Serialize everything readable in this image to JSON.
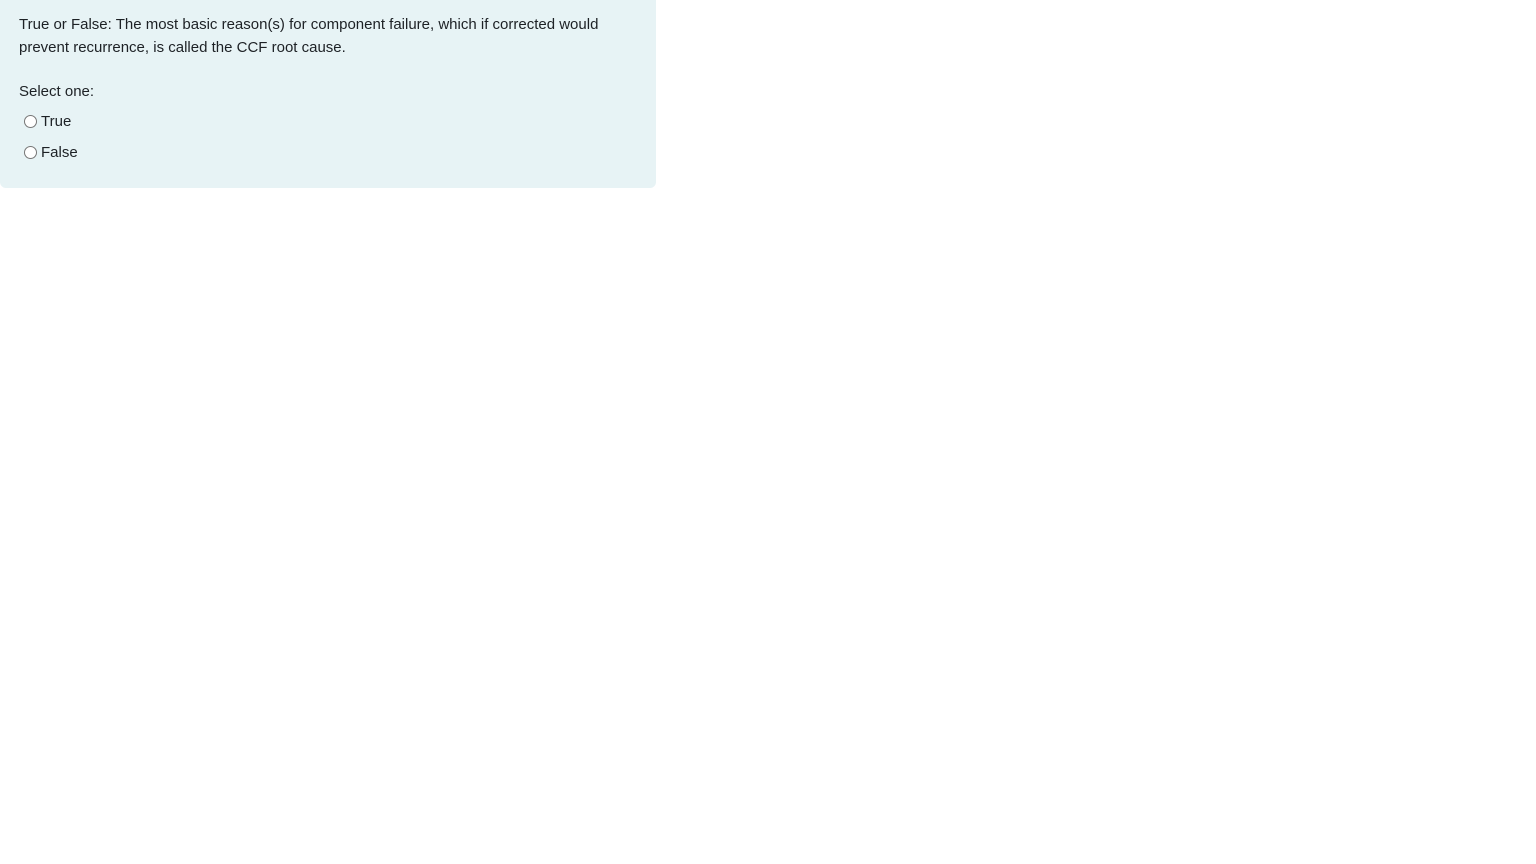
{
  "question": {
    "text": "True or False: The most basic reason(s) for component failure, which if corrected would prevent recurrence, is called the CCF root cause.",
    "prompt": "Select one:",
    "options": [
      {
        "label": "True",
        "selected": false
      },
      {
        "label": "False",
        "selected": false
      }
    ]
  },
  "colors": {
    "card_background": "#e7f3f5",
    "text": "#1d2125"
  }
}
